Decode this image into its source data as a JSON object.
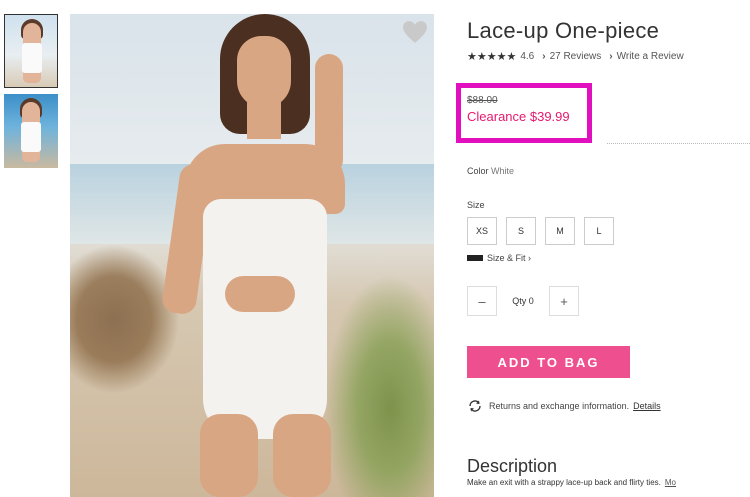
{
  "product": {
    "title": "Lace-up One-piece",
    "rating_value": "4.6",
    "rating_stars": "★★★★★",
    "reviews_link": "27 Reviews",
    "write_review_link": "Write a Review",
    "original_price": "$88.00",
    "clearance_price": "Clearance $39.99",
    "color_label": "Color",
    "color_value": "White",
    "size_label": "Size",
    "sizes": [
      "XS",
      "S",
      "M",
      "L"
    ],
    "size_fit_link": "Size & Fit ›",
    "qty_label": "Qty 0",
    "qty_minus": "–",
    "qty_plus": "+",
    "add_to_bag": "ADD TO BAG",
    "returns_text": "Returns and exchange information.",
    "details_link": "Details",
    "description_title": "Description",
    "description_text": "Make an exit with a strappy lace-up back and flirty ties.",
    "description_more": "Mo"
  },
  "colors": {
    "highlight_box": "#e10fbe",
    "clearance": "#e6196e",
    "add_to_bag_bg": "#ee4f8f"
  },
  "icons": {
    "favorite": "heart-icon",
    "size_fit": "ruler-icon",
    "returns": "refresh-icon"
  }
}
